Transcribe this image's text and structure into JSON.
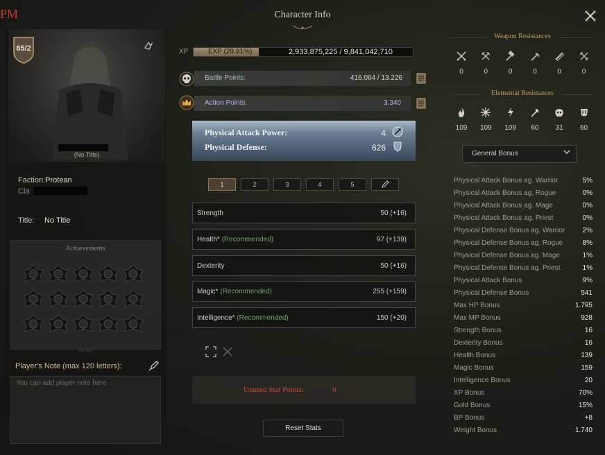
{
  "window": {
    "title": "Character Info",
    "stray_text": "PM"
  },
  "character": {
    "level": "85/2",
    "no_title_under_name": "(No Title)",
    "faction_label": "Faction:",
    "faction_value": "Protean",
    "clan_label": "Cla",
    "title_label": "Title:",
    "title_value": "No Title"
  },
  "achievements": {
    "title": "Achievements",
    "faded_text": "Teller"
  },
  "note": {
    "label": "Player's Note (max 120 letters):",
    "placeholder": "You can add player note here"
  },
  "xp": {
    "label": "XP",
    "percent_text": "EXP (29.81%)",
    "value_text": "2,933,875,225 / 9,841,042,710",
    "fill_fraction": 0.2981
  },
  "points": {
    "battle_label": "Battle Points:",
    "battle_value": "416.064 / 13.226",
    "action_label": "Action Points:",
    "action_value": "3,340"
  },
  "attack": {
    "pap_label": "Physical Attack Power:",
    "pap_value": "4",
    "pd_label": "Physical Defense:",
    "pd_value": "626"
  },
  "presets": [
    "1",
    "2",
    "3",
    "4",
    "5"
  ],
  "stats": [
    {
      "name": "Strength",
      "rec": "",
      "value": "50 (+16)"
    },
    {
      "name": "Health*",
      "rec": "(Recommended)",
      "value": "97 (+139)"
    },
    {
      "name": "Dexterity",
      "rec": "",
      "value": "50 (+16)"
    },
    {
      "name": "Magic*",
      "rec": "(Recommended)",
      "value": "255 (+159)"
    },
    {
      "name": "Intelligence*",
      "rec": "(Recommended)",
      "value": "150 (+20)"
    }
  ],
  "unused": {
    "label": "Unused Stat Points:",
    "value": "0"
  },
  "reset_label": "Reset Stats",
  "weapon_res": {
    "title": "Weapon Resistances",
    "items": [
      {
        "icon": "crossed-swords-icon",
        "value": "0"
      },
      {
        "icon": "crossed-axes-icon",
        "value": "0"
      },
      {
        "icon": "hammer-icon",
        "value": "0"
      },
      {
        "icon": "scythe-icon",
        "value": "0"
      },
      {
        "icon": "double-blade-icon",
        "value": "0"
      },
      {
        "icon": "crossed-daggers-icon",
        "value": "0"
      }
    ]
  },
  "elemental_res": {
    "title": "Elemental Resistances",
    "items": [
      {
        "icon": "fire-icon",
        "value": "109"
      },
      {
        "icon": "frost-icon",
        "value": "109"
      },
      {
        "icon": "lightning-icon",
        "value": "109"
      },
      {
        "icon": "holy-torch-icon",
        "value": "60"
      },
      {
        "icon": "dark-icon",
        "value": "31"
      },
      {
        "icon": "poison-icon",
        "value": "60"
      }
    ]
  },
  "general_bonus": {
    "dropdown_label": "General Bonus",
    "rows": [
      {
        "name": "Physical Attack Bonus ag. Warrior",
        "value": "5%"
      },
      {
        "name": "Physical Attack Bonus ag. Rogue",
        "value": "0%"
      },
      {
        "name": "Physical Attack Bonus ag. Mage",
        "value": "0%"
      },
      {
        "name": "Physical Attack Bonus ag. Priest",
        "value": "0%"
      },
      {
        "name": "Physical Defense Bonus ag. Warrior",
        "value": "2%"
      },
      {
        "name": "Physical Defense Bonus ag. Rogue",
        "value": "8%"
      },
      {
        "name": "Physical Defense Bonus ag. Mage",
        "value": "1%"
      },
      {
        "name": "Physical Defense Bonus ag. Priest",
        "value": "1%"
      },
      {
        "name": "Physical Attack Bonus",
        "value": "9%"
      },
      {
        "name": "Physical Defense Bonus",
        "value": "541"
      },
      {
        "name": "Max HP Bonus",
        "value": "1.795"
      },
      {
        "name": "Max MP Bonus",
        "value": "928"
      },
      {
        "name": "Strength Bonus",
        "value": "16"
      },
      {
        "name": "Dexterity Bonus",
        "value": "16"
      },
      {
        "name": "Health Bonus",
        "value": "139"
      },
      {
        "name": "Magic Bonus",
        "value": "159"
      },
      {
        "name": "Intelligence Bonus",
        "value": "20"
      },
      {
        "name": "XP Bonus",
        "value": "70%"
      },
      {
        "name": "Gold Bonus",
        "value": "15%"
      },
      {
        "name": "BP Bonus",
        "value": "+8"
      },
      {
        "name": "Weight Bonus",
        "value": "1.740"
      }
    ]
  },
  "colors": {
    "accent_gold": "#c79a62",
    "recommended_green": "#6fa46a",
    "unused_red": "#d9443a",
    "action_purple": "#c8a8e8",
    "attack_panel_blue": "#5d6e86"
  }
}
